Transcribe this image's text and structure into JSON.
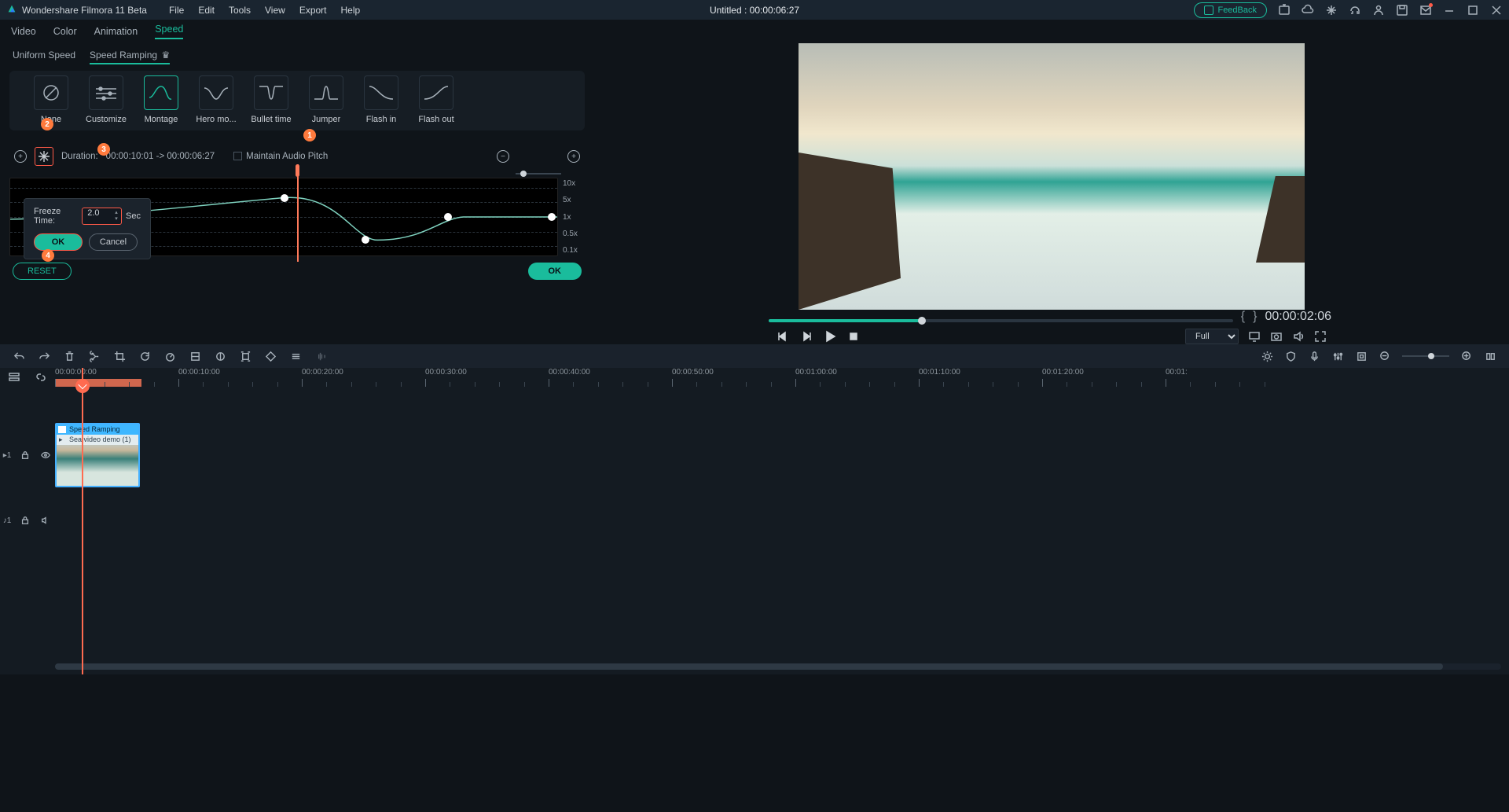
{
  "titlebar": {
    "app_name": "Wondershare Filmora 11 Beta",
    "menu": [
      "File",
      "Edit",
      "Tools",
      "View",
      "Export",
      "Help"
    ],
    "project_title": "Untitled : 00:00:06:27",
    "feedback": "FeedBack"
  },
  "panel_tabs": [
    "Video",
    "Color",
    "Animation",
    "Speed"
  ],
  "panel_tabs_active": "Speed",
  "speed_subtabs": {
    "uniform": "Uniform Speed",
    "ramping": "Speed Ramping"
  },
  "presets": [
    {
      "label": "None"
    },
    {
      "label": "Customize"
    },
    {
      "label": "Montage",
      "selected": true
    },
    {
      "label": "Hero mo..."
    },
    {
      "label": "Bullet time"
    },
    {
      "label": "Jumper"
    },
    {
      "label": "Flash in"
    },
    {
      "label": "Flash out"
    }
  ],
  "ramp": {
    "duration_label": "Duration:",
    "duration_value": "00:00:10:01 -> 00:00:06:27",
    "maintain_pitch": "Maintain Audio Pitch",
    "ylabels": [
      "10x",
      "5x",
      "1x",
      "0.5x",
      "0.1x"
    ]
  },
  "freeze": {
    "label": "Freeze Time:",
    "value": "2.0",
    "unit": "Sec",
    "ok": "OK",
    "cancel": "Cancel"
  },
  "annotations": {
    "a1": "1",
    "a2": "2",
    "a3": "3",
    "a4": "4"
  },
  "footer": {
    "reset": "RESET",
    "ok": "OK"
  },
  "preview": {
    "time": "00:00:02:06",
    "resolution": "Full",
    "brace_open": "{",
    "brace_close": "}"
  },
  "timeline": {
    "timestamps": [
      "00:00:00:00",
      "00:00:10:00",
      "00:00:20:00",
      "00:00:30:00",
      "00:00:40:00",
      "00:00:50:00",
      "00:01:00:00",
      "00:01:10:00",
      "00:01:20:00",
      "00:01:"
    ],
    "track_video": "1",
    "track_audio": "1",
    "clip_effect": "Speed Ramping",
    "clip_name": "Sea video demo (1)"
  }
}
